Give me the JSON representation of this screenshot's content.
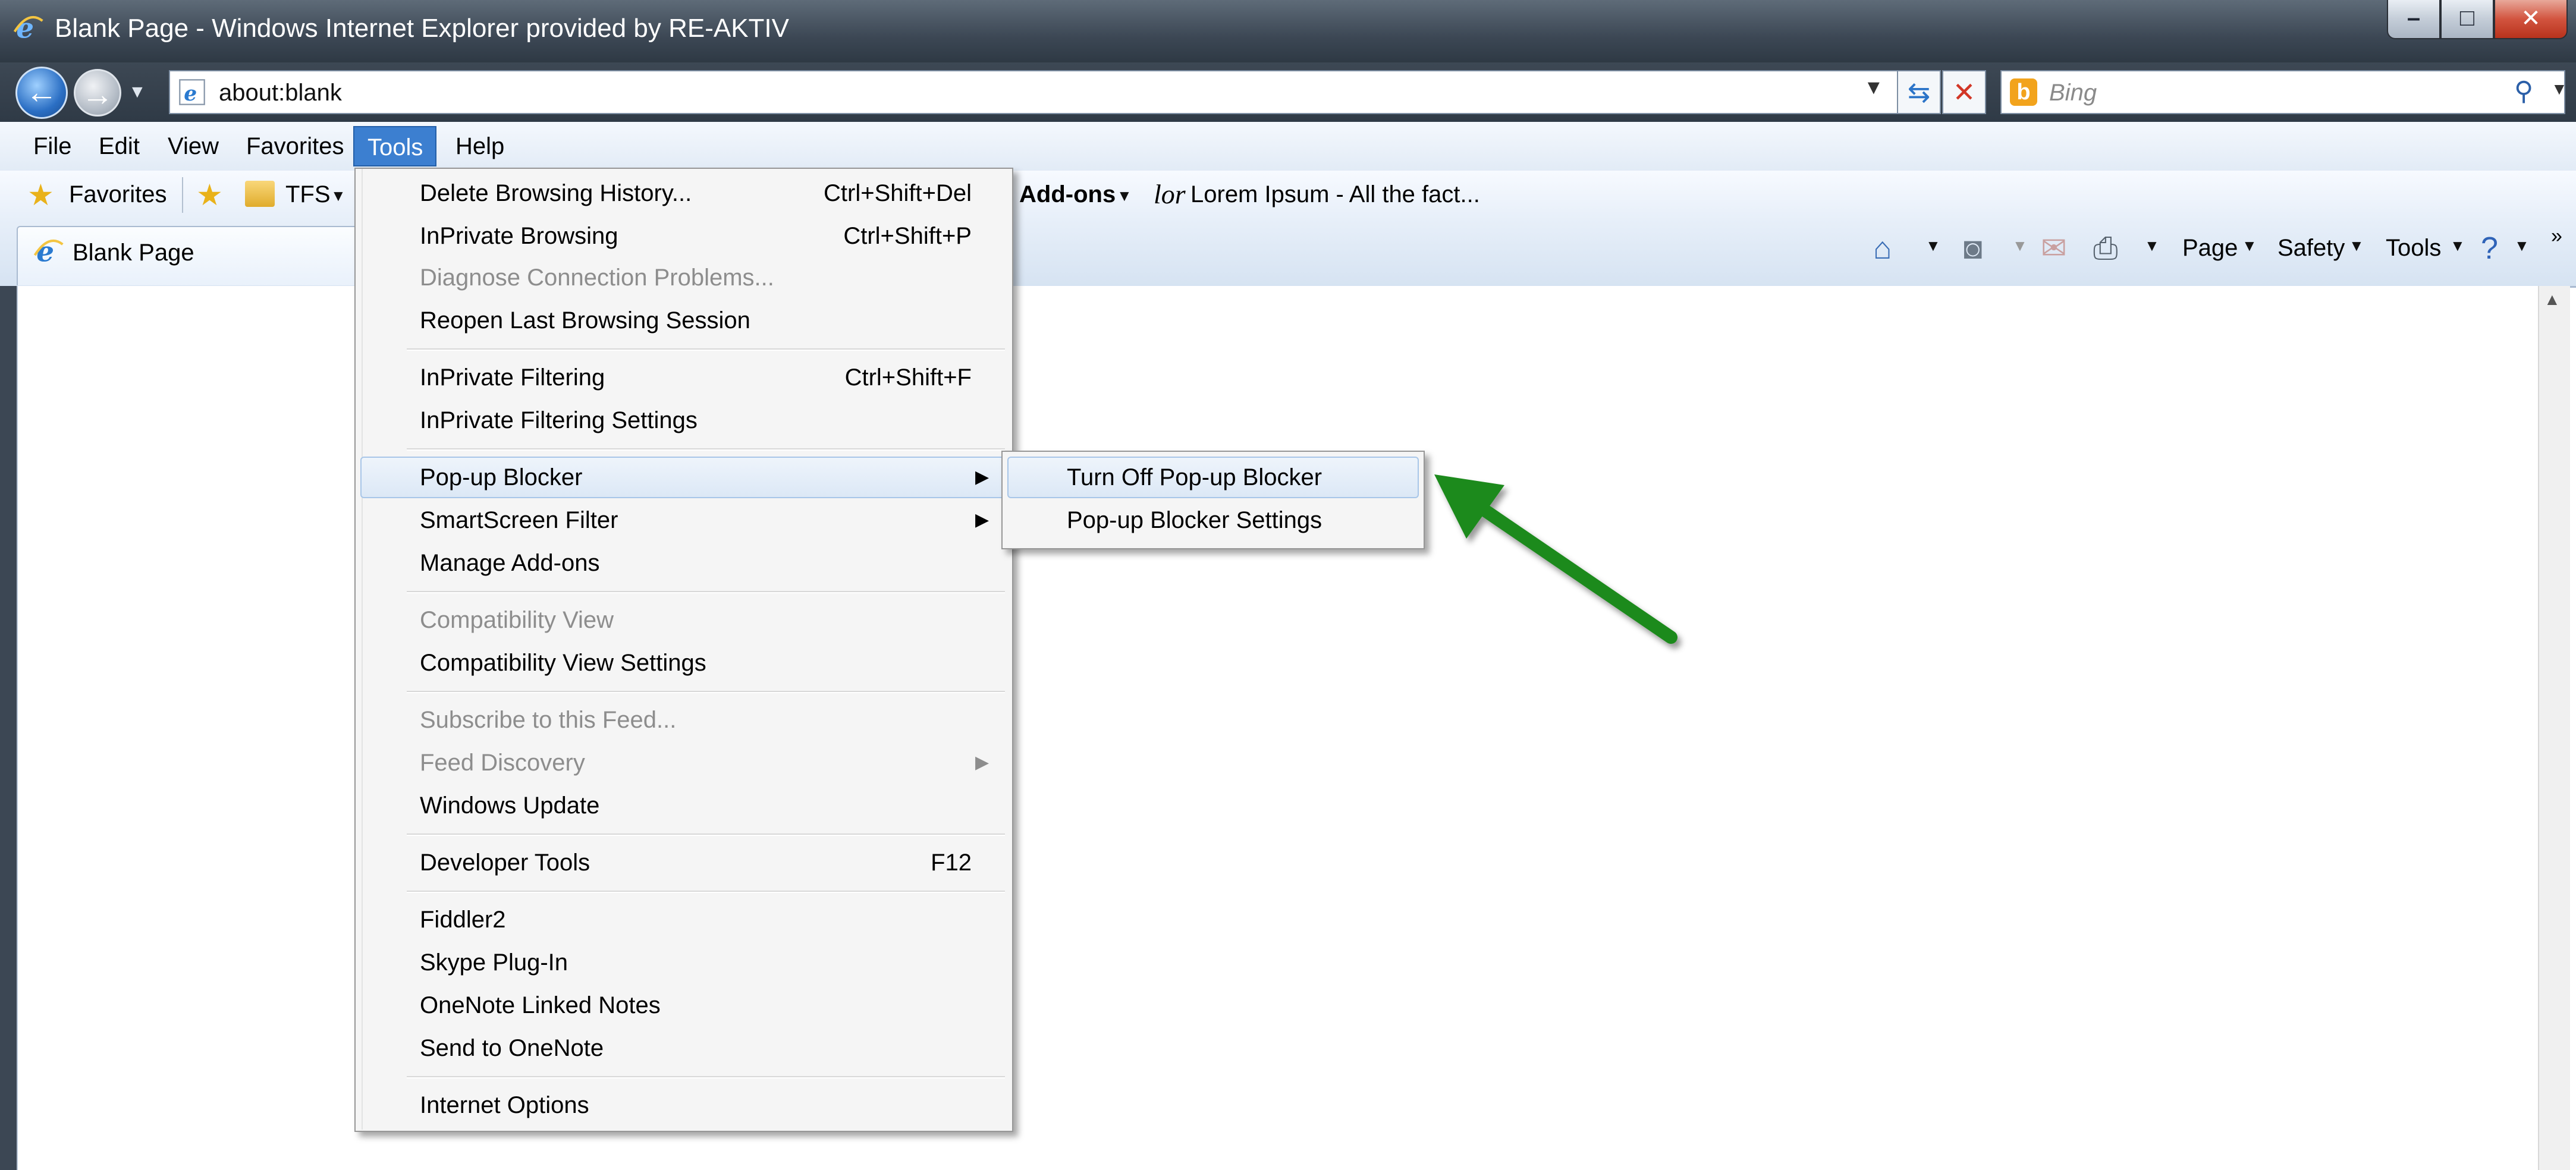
{
  "window": {
    "title": "Blank Page - Windows Internet Explorer provided by RE-AKTIV",
    "min_glyph": "–",
    "max_glyph": "□",
    "close_glyph": "✕"
  },
  "address": {
    "url": "about:blank",
    "search_placeholder": "Bing"
  },
  "menubar": {
    "file": "File",
    "edit": "Edit",
    "view": "View",
    "favorites": "Favorites",
    "tools": "Tools",
    "help": "Help"
  },
  "favbar": {
    "favorites_label": "Favorites",
    "tfs_label": "TFS",
    "addons_label": "Add-ons",
    "lorem_prefix": "lor",
    "lorem_label": "Lorem Ipsum - All the fact..."
  },
  "tab": {
    "title": "Blank Page"
  },
  "commandbar": {
    "page": "Page",
    "safety": "Safety",
    "tools": "Tools"
  },
  "tools_menu": {
    "items": [
      {
        "label": "Delete Browsing History...",
        "shortcut": "Ctrl+Shift+Del",
        "disabled": false
      },
      {
        "label": "InPrivate Browsing",
        "shortcut": "Ctrl+Shift+P",
        "disabled": false
      },
      {
        "label": "Diagnose Connection Problems...",
        "shortcut": "",
        "disabled": true
      },
      {
        "label": "Reopen Last Browsing Session",
        "shortcut": "",
        "disabled": false
      },
      {
        "label": "InPrivate Filtering",
        "shortcut": "Ctrl+Shift+F",
        "disabled": false
      },
      {
        "label": "InPrivate Filtering Settings",
        "shortcut": "",
        "disabled": false
      },
      {
        "label": "Pop-up Blocker",
        "shortcut": "",
        "disabled": false,
        "submenu": true
      },
      {
        "label": "SmartScreen Filter",
        "shortcut": "",
        "disabled": false,
        "submenu": true
      },
      {
        "label": "Manage Add-ons",
        "shortcut": "",
        "disabled": false
      },
      {
        "label": "Compatibility View",
        "shortcut": "",
        "disabled": true
      },
      {
        "label": "Compatibility View Settings",
        "shortcut": "",
        "disabled": false
      },
      {
        "label": "Subscribe to this Feed...",
        "shortcut": "",
        "disabled": true
      },
      {
        "label": "Feed Discovery",
        "shortcut": "",
        "disabled": true,
        "submenu": true
      },
      {
        "label": "Windows Update",
        "shortcut": "",
        "disabled": false
      },
      {
        "label": "Developer Tools",
        "shortcut": "F12",
        "disabled": false
      },
      {
        "label": "Fiddler2",
        "shortcut": "",
        "disabled": false
      },
      {
        "label": "Skype Plug-In",
        "shortcut": "",
        "disabled": false
      },
      {
        "label": "OneNote Linked Notes",
        "shortcut": "",
        "disabled": false
      },
      {
        "label": "Send to OneNote",
        "shortcut": "",
        "disabled": false
      },
      {
        "label": "Internet Options",
        "shortcut": "",
        "disabled": false
      }
    ]
  },
  "popup_submenu": {
    "items": [
      {
        "label": "Turn Off Pop-up Blocker"
      },
      {
        "label": "Pop-up Blocker Settings"
      }
    ]
  },
  "colors": {
    "highlight": "#3c7fd0",
    "annotation_arrow": "#1e8a1e"
  }
}
